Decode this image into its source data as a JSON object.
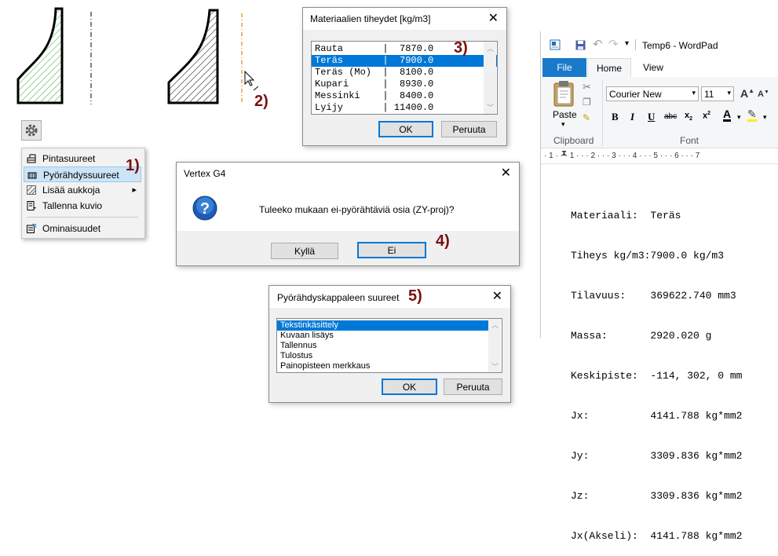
{
  "steps": {
    "s1": "1)",
    "s2": "2)",
    "s3": "3)",
    "s4": "4)",
    "s5": "5)"
  },
  "context_menu": {
    "items": [
      {
        "label": "Pintasuureet",
        "icon": "area-properties-icon"
      },
      {
        "label": "Pyörähdyssuureet",
        "icon": "revolution-properties-icon"
      },
      {
        "label": "Lisää aukkoja",
        "icon": "hatch-icon"
      },
      {
        "label": "Tallenna kuvio",
        "icon": "save-pattern-icon"
      },
      {
        "label": "Ominaisuudet",
        "icon": "properties-icon"
      }
    ],
    "submenu_arrow": "▸"
  },
  "density_dialog": {
    "title": "Materiaalien tiheydet [kg/m3]",
    "rows": [
      "Rauta       |  7870.0",
      "Teräs       |  7900.0",
      "Teräs (Mo)  |  8100.0",
      "Kupari      |  8930.0",
      "Messinki    |  8400.0",
      "Lyijy       | 11400.0"
    ],
    "selected_index": 1,
    "ok": "OK",
    "cancel": "Peruuta"
  },
  "question_dialog": {
    "title": "Vertex G4",
    "message": "Tuleeko mukaan ei-pyörähtäviä osia (ZY-proj)?",
    "yes": "Kyllä",
    "no": "Ei"
  },
  "quantities_dialog": {
    "title": "Pyörähdyskappaleen suureet",
    "items": [
      "Tekstinkäsittely",
      "Kuvaan lisäys",
      "Tallennus",
      "Tulostus",
      "Painopisteen merkkaus"
    ],
    "selected_index": 0,
    "ok": "OK",
    "cancel": "Peruuta"
  },
  "wordpad": {
    "title": "Temp6 - WordPad",
    "tabs": {
      "file": "File",
      "home": "Home",
      "view": "View"
    },
    "font_name": "Courier New",
    "font_size": "11",
    "paste": "Paste",
    "group_clipboard": "Clipboard",
    "group_font": "Font",
    "ruler": "· 1 · · · 1 · · · 2 · · · 3 · · · 4 · · · 5 · · · 6 · · · 7",
    "lines": [
      "Materiaali:  Teräs",
      "Tiheys kg/m3:7900.0 kg/m3",
      "Tilavuus:    369622.740 mm3",
      "Massa:       2920.020 g",
      "Keskipiste:  -114, 302, 0 mm",
      "Jx:          4141.788 kg*mm2",
      "Jy:          3309.836 kg*mm2",
      "Jz:          3309.836 kg*mm2",
      "Jx(Akseli):  4141.788 kg*mm2"
    ]
  },
  "colors": {
    "accent": "#0078d7",
    "step": "#7a1010",
    "hatch_green": "#2ea82e",
    "axis_orange": "#e08a00"
  }
}
